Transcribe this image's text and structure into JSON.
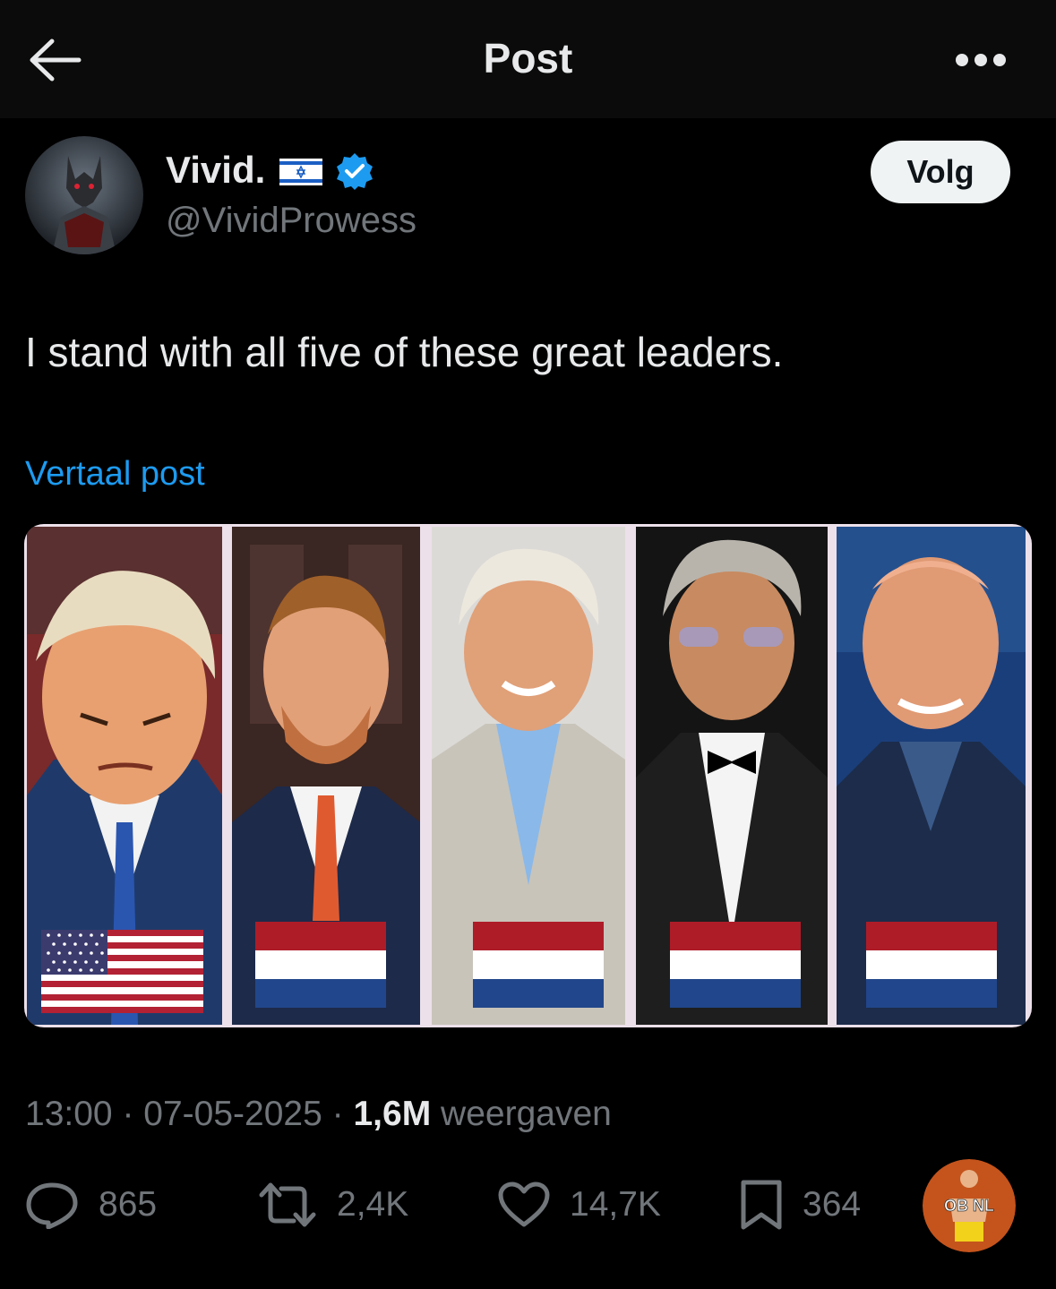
{
  "header": {
    "title": "Post",
    "back_icon": "arrow-left-icon",
    "more_icon": "more-horizontal-icon"
  },
  "author": {
    "name": "Vivid.",
    "flag_icon": "israel-flag-icon",
    "verified_icon": "verified-badge-icon",
    "handle": "@VividProwess",
    "follow_label": "Volg"
  },
  "post": {
    "text": "I stand with all five of these great leaders.",
    "translate_label": "Vertaal post"
  },
  "media": {
    "panels": [
      {
        "flag": "us-flag-icon"
      },
      {
        "flag": "netherlands-flag-icon"
      },
      {
        "flag": "netherlands-flag-icon"
      },
      {
        "flag": "netherlands-flag-icon"
      },
      {
        "flag": "netherlands-flag-icon"
      }
    ]
  },
  "meta": {
    "time": "13:00",
    "date": "07-05-2025",
    "views_count": "1,6M",
    "views_label": "weergaven"
  },
  "actions": {
    "replies": "865",
    "reposts": "2,4K",
    "likes": "14,7K",
    "bookmarks": "364",
    "badge_text": "OB NL"
  },
  "colors": {
    "accent": "#1d9bf0",
    "text": "#e7e9ea",
    "muted": "#71767b",
    "background": "#000000"
  }
}
